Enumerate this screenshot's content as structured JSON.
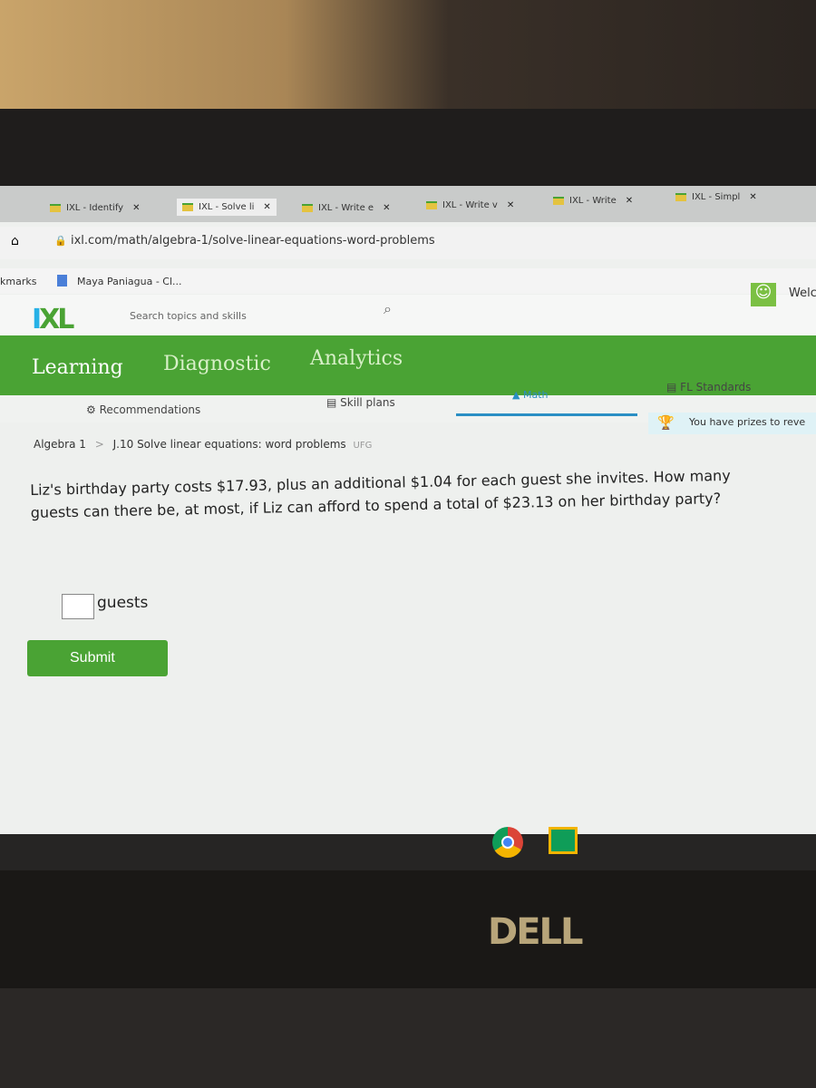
{
  "browser": {
    "tabs": [
      {
        "label": "IXL - Identify"
      },
      {
        "label": "IXL - Solve li"
      },
      {
        "label": "IXL - Write e"
      },
      {
        "label": "IXL - Write v"
      },
      {
        "label": "IXL - Write"
      },
      {
        "label": "IXL - Simpl"
      }
    ],
    "close_glyph": "✕",
    "url": "ixl.com/math/algebra-1/solve-linear-equations-word-problems",
    "bookmarks_label": "kmarks",
    "bookmark_item": "Maya Paniagua - Cl...",
    "welcome": "Welc"
  },
  "ixl": {
    "logo": {
      "i": "I",
      "xl": "XL"
    },
    "search_placeholder": "Search topics and skills",
    "nav": [
      "Learning",
      "Diagnostic",
      "Analytics"
    ],
    "subnav": [
      "Recommendations",
      "Skill plans",
      "Math",
      "FL Standards"
    ],
    "prize_text": "You have prizes to reve",
    "breadcrumb": {
      "parent": "Algebra 1",
      "separator": ">",
      "skill": "J.10 Solve linear equations: word problems",
      "code": "UFG"
    },
    "question": "Liz's birthday party costs $17.93, plus an additional $1.04 for each guest she invites. How many guests can there be, at most, if Liz can afford to spend a total of $23.13 on her birthday party?",
    "answer_value": "",
    "answer_unit": "guests",
    "submit_label": "Submit"
  },
  "device": {
    "brand": "DELL"
  },
  "colors": {
    "accent": "#4aa334",
    "math_underline": "#2a8fc4"
  }
}
